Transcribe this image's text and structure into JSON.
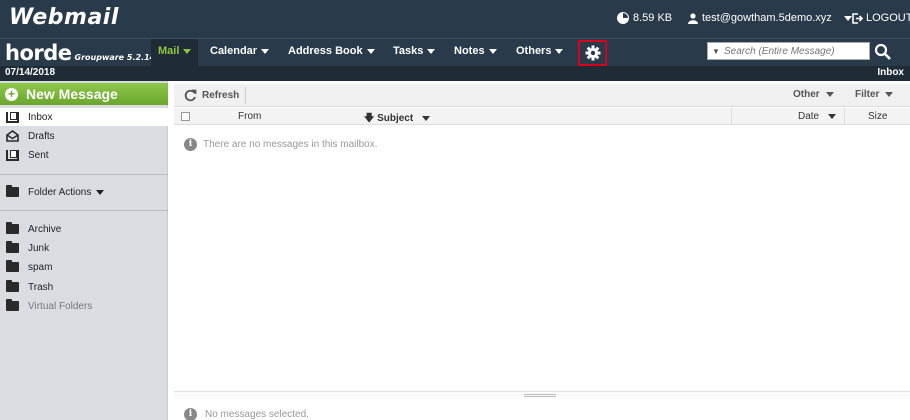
{
  "topbar": {
    "brand": "Webmail",
    "disk_usage": "8.59 KB",
    "user": "test@gowtham.5demo.xyz",
    "logout": "LOGOUT"
  },
  "navbar": {
    "logo": "horde",
    "logo_sub": "Groupware 5.2.14",
    "items": [
      {
        "label": "Mail",
        "active": true
      },
      {
        "label": "Calendar"
      },
      {
        "label": "Address Book"
      },
      {
        "label": "Tasks"
      },
      {
        "label": "Notes"
      },
      {
        "label": "Others"
      }
    ],
    "search_placeholder": "Search (Entire Message)"
  },
  "infobar": {
    "date": "07/14/2018",
    "mailbox": "Inbox"
  },
  "sidebar": {
    "new_message": "New Message",
    "folders_top": [
      "Inbox",
      "Drafts",
      "Sent"
    ],
    "folder_actions": "Folder Actions",
    "folders": [
      "Archive",
      "Junk",
      "spam",
      "Trash"
    ],
    "virtual_folders": "Virtual Folders"
  },
  "toolbar": {
    "refresh": "Refresh",
    "other": "Other",
    "filter": "Filter"
  },
  "columns": {
    "from": "From",
    "subject": "Subject",
    "date": "Date",
    "size": "Size"
  },
  "messages": {
    "empty": "There are no messages in this mailbox.",
    "preview": "No messages selected."
  },
  "colors": {
    "topbar_bg": "#293a4a",
    "accent_green": "#8cc63e",
    "highlight_red": "#d8001b"
  }
}
